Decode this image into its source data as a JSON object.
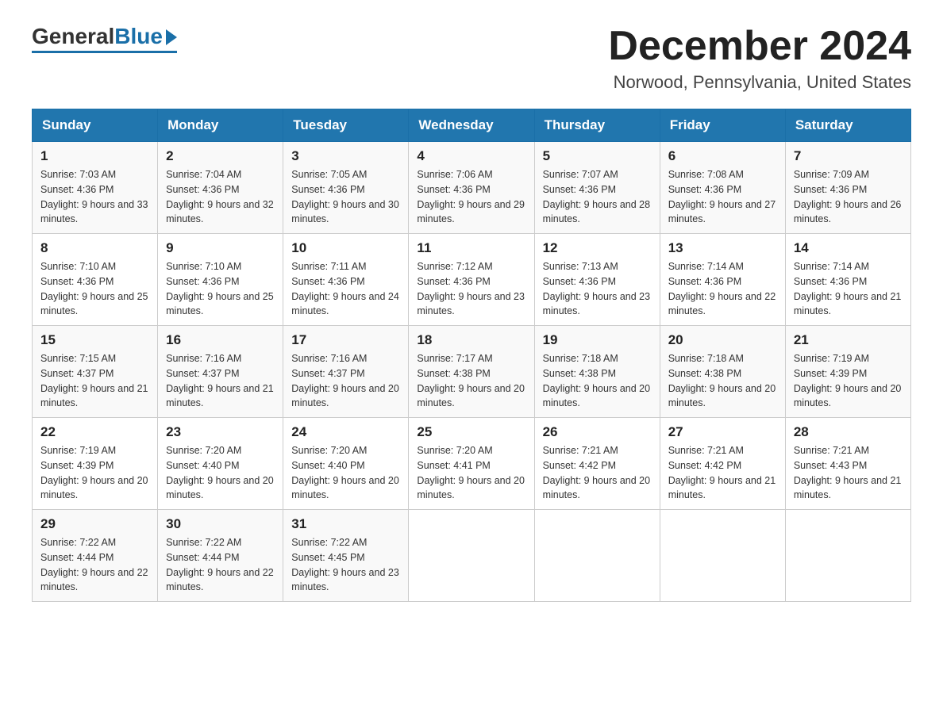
{
  "logo": {
    "general": "General",
    "blue": "Blue"
  },
  "header": {
    "month_year": "December 2024",
    "location": "Norwood, Pennsylvania, United States"
  },
  "weekdays": [
    "Sunday",
    "Monday",
    "Tuesday",
    "Wednesday",
    "Thursday",
    "Friday",
    "Saturday"
  ],
  "weeks": [
    [
      {
        "day": "1",
        "sunrise": "7:03 AM",
        "sunset": "4:36 PM",
        "daylight": "9 hours and 33 minutes."
      },
      {
        "day": "2",
        "sunrise": "7:04 AM",
        "sunset": "4:36 PM",
        "daylight": "9 hours and 32 minutes."
      },
      {
        "day": "3",
        "sunrise": "7:05 AM",
        "sunset": "4:36 PM",
        "daylight": "9 hours and 30 minutes."
      },
      {
        "day": "4",
        "sunrise": "7:06 AM",
        "sunset": "4:36 PM",
        "daylight": "9 hours and 29 minutes."
      },
      {
        "day": "5",
        "sunrise": "7:07 AM",
        "sunset": "4:36 PM",
        "daylight": "9 hours and 28 minutes."
      },
      {
        "day": "6",
        "sunrise": "7:08 AM",
        "sunset": "4:36 PM",
        "daylight": "9 hours and 27 minutes."
      },
      {
        "day": "7",
        "sunrise": "7:09 AM",
        "sunset": "4:36 PM",
        "daylight": "9 hours and 26 minutes."
      }
    ],
    [
      {
        "day": "8",
        "sunrise": "7:10 AM",
        "sunset": "4:36 PM",
        "daylight": "9 hours and 25 minutes."
      },
      {
        "day": "9",
        "sunrise": "7:10 AM",
        "sunset": "4:36 PM",
        "daylight": "9 hours and 25 minutes."
      },
      {
        "day": "10",
        "sunrise": "7:11 AM",
        "sunset": "4:36 PM",
        "daylight": "9 hours and 24 minutes."
      },
      {
        "day": "11",
        "sunrise": "7:12 AM",
        "sunset": "4:36 PM",
        "daylight": "9 hours and 23 minutes."
      },
      {
        "day": "12",
        "sunrise": "7:13 AM",
        "sunset": "4:36 PM",
        "daylight": "9 hours and 23 minutes."
      },
      {
        "day": "13",
        "sunrise": "7:14 AM",
        "sunset": "4:36 PM",
        "daylight": "9 hours and 22 minutes."
      },
      {
        "day": "14",
        "sunrise": "7:14 AM",
        "sunset": "4:36 PM",
        "daylight": "9 hours and 21 minutes."
      }
    ],
    [
      {
        "day": "15",
        "sunrise": "7:15 AM",
        "sunset": "4:37 PM",
        "daylight": "9 hours and 21 minutes."
      },
      {
        "day": "16",
        "sunrise": "7:16 AM",
        "sunset": "4:37 PM",
        "daylight": "9 hours and 21 minutes."
      },
      {
        "day": "17",
        "sunrise": "7:16 AM",
        "sunset": "4:37 PM",
        "daylight": "9 hours and 20 minutes."
      },
      {
        "day": "18",
        "sunrise": "7:17 AM",
        "sunset": "4:38 PM",
        "daylight": "9 hours and 20 minutes."
      },
      {
        "day": "19",
        "sunrise": "7:18 AM",
        "sunset": "4:38 PM",
        "daylight": "9 hours and 20 minutes."
      },
      {
        "day": "20",
        "sunrise": "7:18 AM",
        "sunset": "4:38 PM",
        "daylight": "9 hours and 20 minutes."
      },
      {
        "day": "21",
        "sunrise": "7:19 AM",
        "sunset": "4:39 PM",
        "daylight": "9 hours and 20 minutes."
      }
    ],
    [
      {
        "day": "22",
        "sunrise": "7:19 AM",
        "sunset": "4:39 PM",
        "daylight": "9 hours and 20 minutes."
      },
      {
        "day": "23",
        "sunrise": "7:20 AM",
        "sunset": "4:40 PM",
        "daylight": "9 hours and 20 minutes."
      },
      {
        "day": "24",
        "sunrise": "7:20 AM",
        "sunset": "4:40 PM",
        "daylight": "9 hours and 20 minutes."
      },
      {
        "day": "25",
        "sunrise": "7:20 AM",
        "sunset": "4:41 PM",
        "daylight": "9 hours and 20 minutes."
      },
      {
        "day": "26",
        "sunrise": "7:21 AM",
        "sunset": "4:42 PM",
        "daylight": "9 hours and 20 minutes."
      },
      {
        "day": "27",
        "sunrise": "7:21 AM",
        "sunset": "4:42 PM",
        "daylight": "9 hours and 21 minutes."
      },
      {
        "day": "28",
        "sunrise": "7:21 AM",
        "sunset": "4:43 PM",
        "daylight": "9 hours and 21 minutes."
      }
    ],
    [
      {
        "day": "29",
        "sunrise": "7:22 AM",
        "sunset": "4:44 PM",
        "daylight": "9 hours and 22 minutes."
      },
      {
        "day": "30",
        "sunrise": "7:22 AM",
        "sunset": "4:44 PM",
        "daylight": "9 hours and 22 minutes."
      },
      {
        "day": "31",
        "sunrise": "7:22 AM",
        "sunset": "4:45 PM",
        "daylight": "9 hours and 23 minutes."
      },
      null,
      null,
      null,
      null
    ]
  ]
}
